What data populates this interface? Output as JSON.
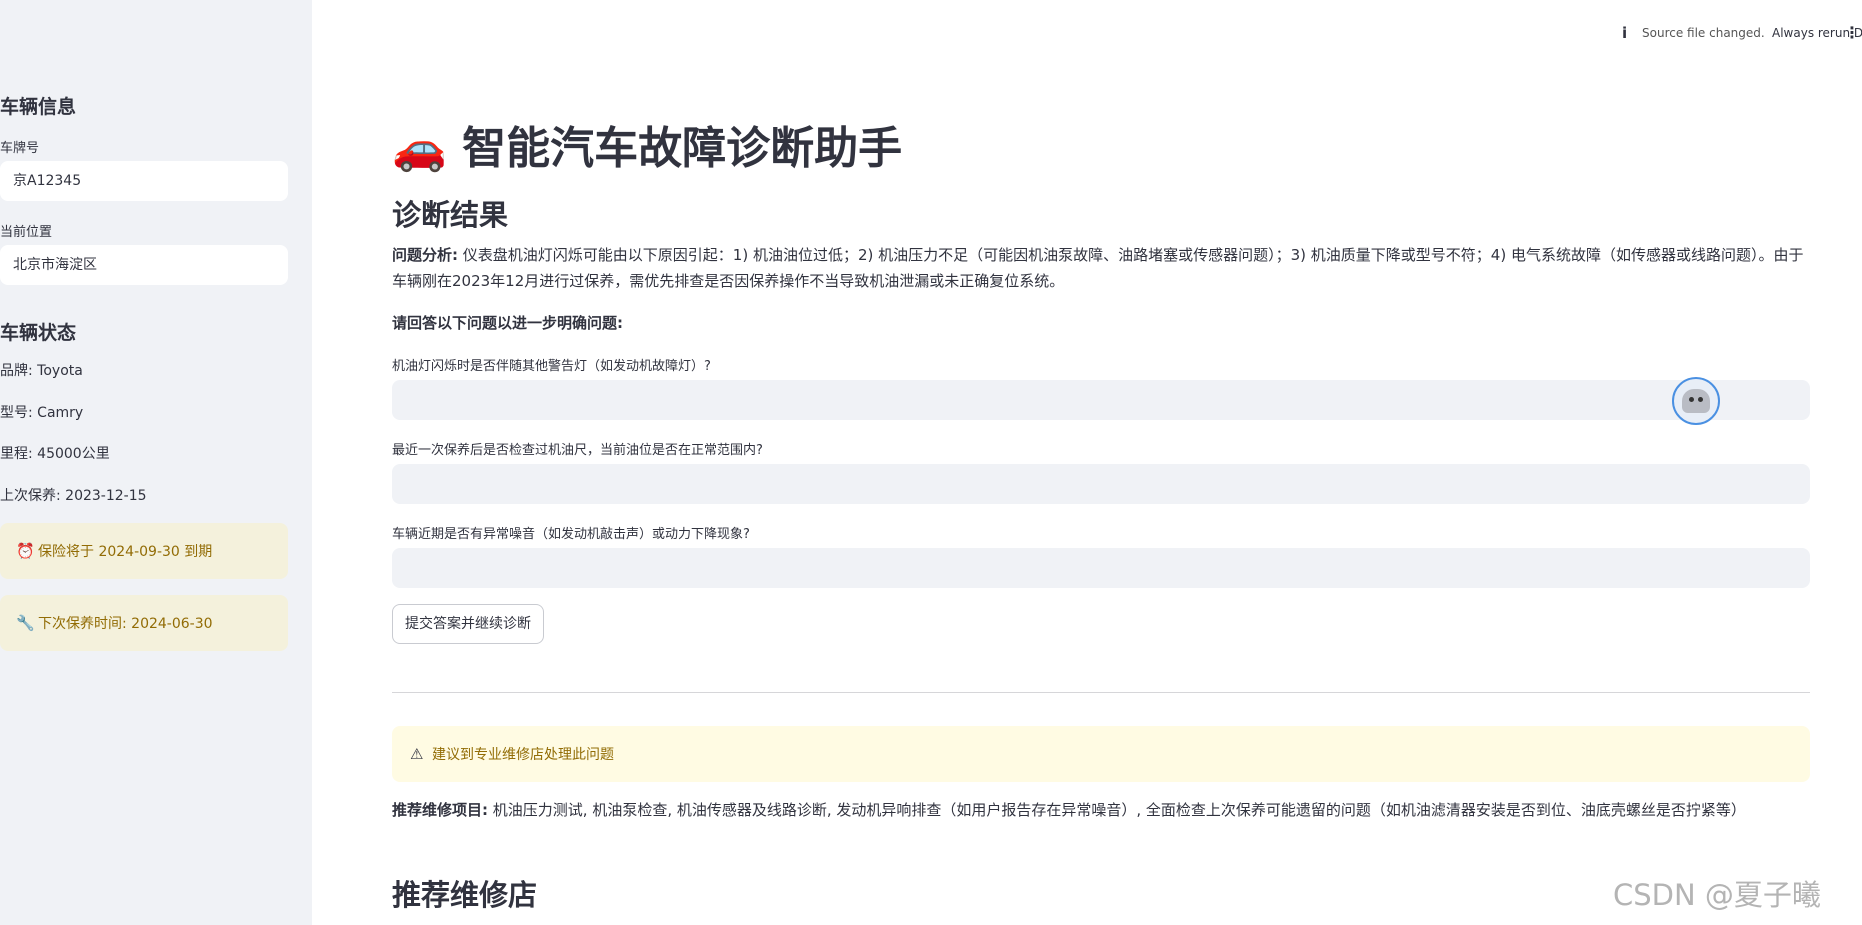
{
  "sidebar": {
    "vehicle_info_heading": "车辆信息",
    "plate_label": "车牌号",
    "plate_value": "京A12345",
    "location_label": "当前位置",
    "location_value": "北京市海淀区",
    "status_heading": "车辆状态",
    "brand": "品牌: Toyota",
    "model": "型号: Camry",
    "mileage": "里程: 45000公里",
    "last_service": "上次保养: 2023-12-15",
    "insurance_alert": "保险将于 2024-09-30 到期",
    "insurance_icon": "⏰",
    "next_service_alert": "下次保养时间: 2024-06-30",
    "next_service_icon": "🔧"
  },
  "topbar": {
    "info_icon": "i",
    "source_text": "Source file changed.",
    "deploy_text": "Always rerun Deploy",
    "menu_icon": "⋮"
  },
  "main": {
    "title_icon": "🚗",
    "title": "智能汽车故障诊断助手",
    "diagnosis_heading": "诊断结果",
    "analysis_label": "问题分析:",
    "analysis_text": "仪表盘机油灯闪烁可能由以下原因引起：1) 机油油位过低；2) 机油压力不足（可能因机油泵故障、油路堵塞或传感器问题）；3) 机油质量下降或型号不符；4) 电气系统故障（如传感器或线路问题）。由于车辆刚在2023年12月进行过保养，需优先排查是否因保养操作不当导致机油泄漏或未正确复位系统。",
    "questions_heading": "请回答以下问题以进一步明确问题:",
    "questions": [
      {
        "label": "机油灯闪烁时是否伴随其他警告灯（如发动机故障灯）?",
        "value": ""
      },
      {
        "label": "最近一次保养后是否检查过机油尺，当前油位是否在正常范围内?",
        "value": ""
      },
      {
        "label": "车辆近期是否有异常噪音（如发动机敲击声）或动力下降现象?",
        "value": ""
      }
    ],
    "submit_label": "提交答案并继续诊断",
    "warning_icon": "⚠",
    "warning_text": "建议到专业维修店处理此问题",
    "repair_label": "推荐维修项目:",
    "repair_text": "机油压力测试, 机油泵检查, 机油传感器及线路诊断, 发动机异响排查（如用户报告存在异常噪音）, 全面检查上次保养可能遗留的问题（如机油滤清器安装是否到位、油底壳螺丝是否拧紧等）",
    "shops_heading": "推荐维修店"
  },
  "watermark": "CSDN @夏子曦",
  "colors": {
    "sidebar_bg": "#f0f2f6",
    "alert_bg": "#f4f1dc",
    "alert_text": "#926c05",
    "warning_bg": "#fffbe3",
    "text": "#31333f"
  }
}
